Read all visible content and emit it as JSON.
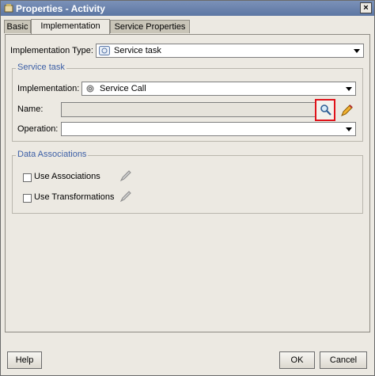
{
  "window": {
    "title": "Properties - Activity",
    "close_glyph": "×"
  },
  "tabs": [
    {
      "label": "Basic"
    },
    {
      "label": "Implementation",
      "active": true
    },
    {
      "label": "Service Properties"
    }
  ],
  "implementation_type": {
    "label": "Implementation Type:",
    "value": "Service task",
    "icon": "service-task-icon"
  },
  "service_task": {
    "group_label": "Service task",
    "implementation": {
      "label": "Implementation:",
      "value": "Service Call",
      "icon": "gear-icon"
    },
    "name": {
      "label": "Name:",
      "value": ""
    },
    "operation": {
      "label": "Operation:",
      "value": ""
    }
  },
  "data_associations": {
    "group_label": "Data Associations",
    "use_associations": {
      "label": "Use Associations",
      "checked": false
    },
    "use_transformations": {
      "label": "Use Transformations",
      "checked": false
    }
  },
  "footer": {
    "help": "Help",
    "ok": "OK",
    "cancel": "Cancel"
  },
  "colors": {
    "highlight": "#e0121a",
    "group_label": "#3c5fa6"
  }
}
